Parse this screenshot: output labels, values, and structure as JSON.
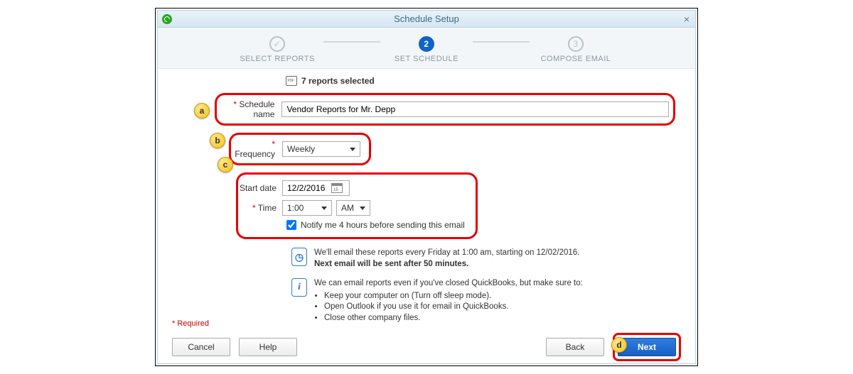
{
  "dialog": {
    "title": "Schedule Setup"
  },
  "stepper": {
    "step1": {
      "label": "SELECT REPORTS"
    },
    "step2": {
      "label": "SET SCHEDULE",
      "num": "2"
    },
    "step3": {
      "label": "COMPOSE EMAIL",
      "num": "3"
    }
  },
  "form": {
    "reports_selected": "7 reports selected",
    "schedule_name_label": "Schedule name",
    "schedule_name_value": "Vendor Reports for Mr. Depp",
    "frequency_label": "Frequency",
    "frequency_value": "Weekly",
    "start_date_label": "Start date",
    "start_date_value": "12/2/2016",
    "time_label": "Time",
    "time_value": "1:00",
    "ampm_value": "AM",
    "notify_label": "Notify me 4 hours before sending this email",
    "notify_checked": true
  },
  "info": {
    "schedule_line": "We'll email these reports every Friday at 1:00 am, starting on 12/02/2016.",
    "next_email_line": "Next email will be sent after 50 minutes.",
    "tips_intro": "We can email reports even if you've closed QuickBooks, but make sure to:",
    "tips": {
      "t1": "Keep your computer on (Turn off sleep mode).",
      "t2": "Open Outlook if you use it for email in QuickBooks.",
      "t3": "Close other company files."
    }
  },
  "required_note": "* Required",
  "buttons": {
    "cancel": "Cancel",
    "help": "Help",
    "back": "Back",
    "next": "Next"
  },
  "callouts": {
    "a": "a",
    "b": "b",
    "c": "c",
    "d": "d"
  }
}
